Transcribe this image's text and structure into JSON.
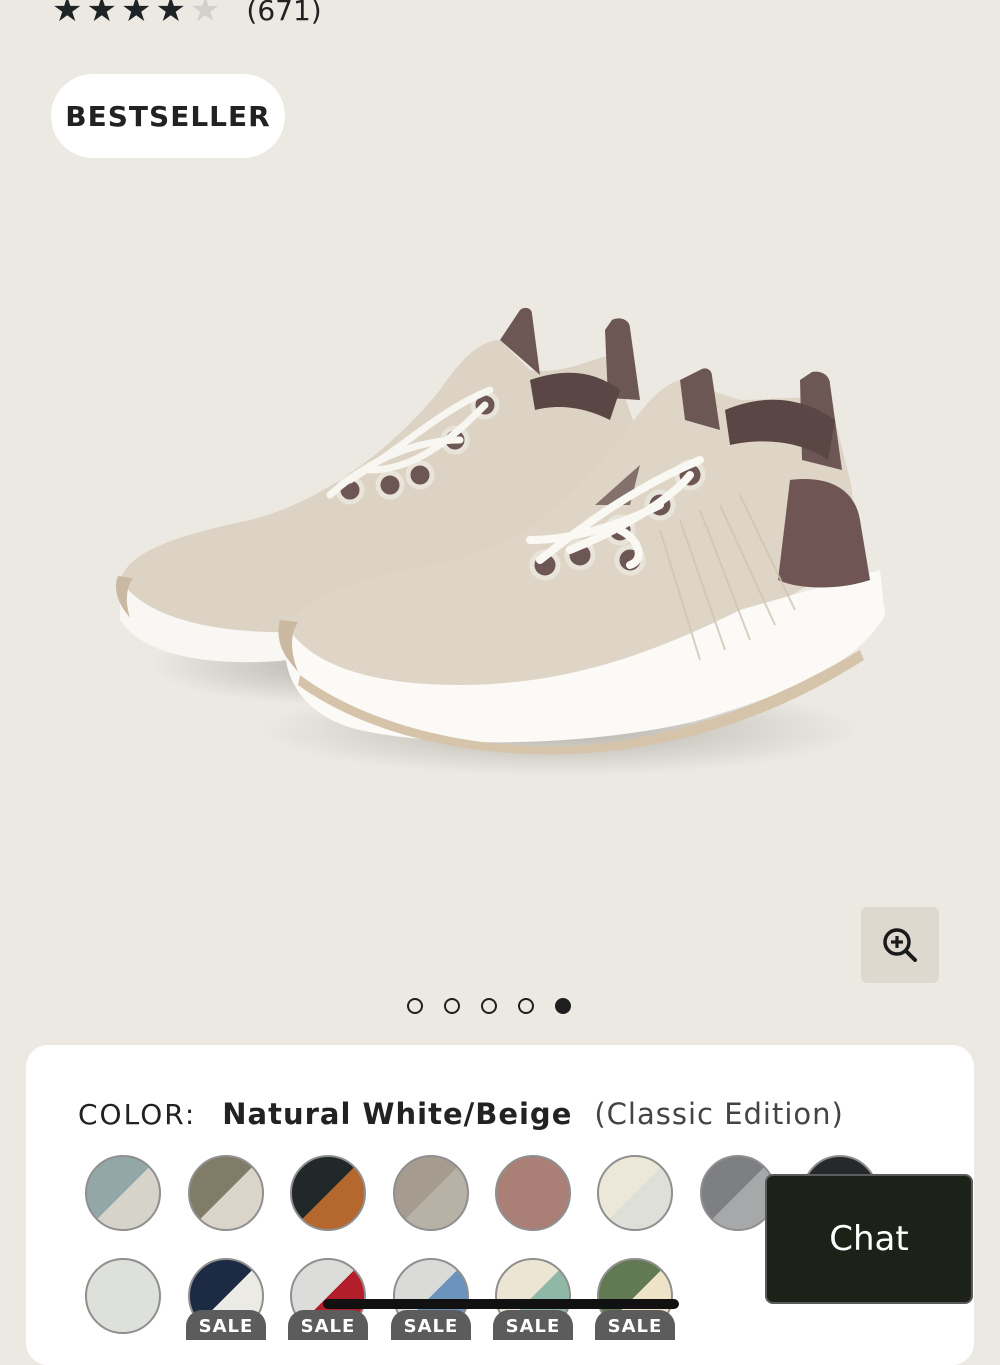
{
  "rating": {
    "stars_filled": 4,
    "stars_total": 5,
    "count_text": "(671)"
  },
  "badge": {
    "label": "BESTSELLER"
  },
  "gallery": {
    "slides": 5,
    "active_index": 4
  },
  "color": {
    "label": "COLOR:",
    "selected_name": "Natural White/Beige",
    "edition": "(Classic Edition)"
  },
  "swatches_row1": [
    {
      "a": "#93A7A9",
      "b": "#D6D3CB"
    },
    {
      "a": "#807C68",
      "b": "#DBD5C9"
    },
    {
      "a": "#22272A",
      "b": "#B5682E"
    },
    {
      "a": "#A59C8F",
      "b": "#B8B1A6"
    },
    {
      "a": "#A97F76",
      "b": "#A97F76"
    },
    {
      "a": "#ECE8D9",
      "b": "#DEDFD8",
      "selected": true
    },
    {
      "a": "#7E7F82",
      "b": "#A7A8AA"
    },
    {
      "a": "#25292C",
      "b": "#25292C"
    }
  ],
  "swatches_row2": [
    {
      "a": "#DEE0DB",
      "b": "#DEE0DB",
      "sale": false
    },
    {
      "a": "#1C2A44",
      "b": "#ECEAE4",
      "sale": true
    },
    {
      "a": "#DCDCDA",
      "b": "#B21E2A",
      "sale": true
    },
    {
      "a": "#DADBD8",
      "b": "#6C93BC",
      "sale": true
    },
    {
      "a": "#EDE5D3",
      "b": "#8FB9A6",
      "sale": true
    },
    {
      "a": "#627A53",
      "b": "#EDE3C6",
      "sale": true
    }
  ],
  "sale_label": "SALE",
  "chat": {
    "label": "Chat"
  }
}
